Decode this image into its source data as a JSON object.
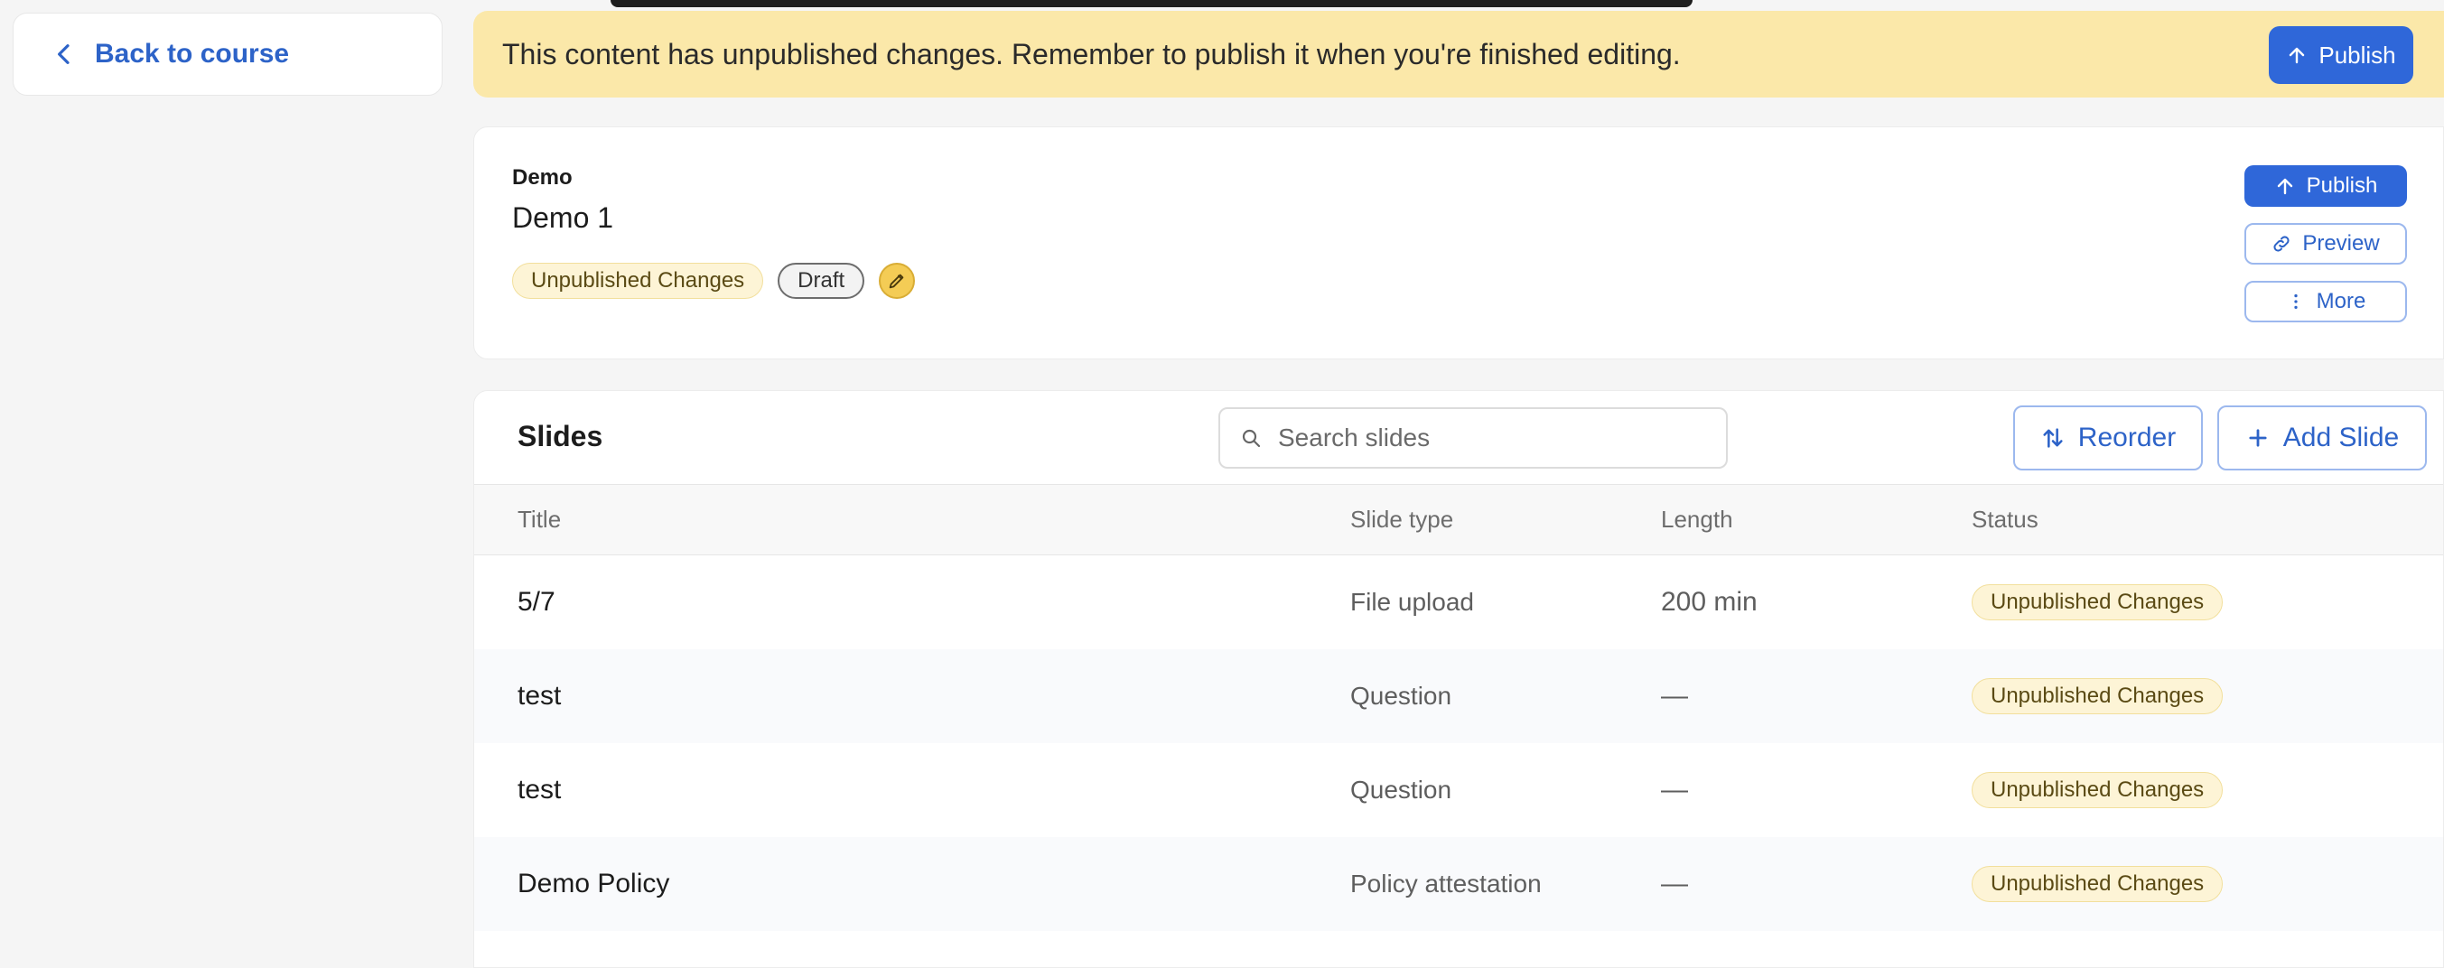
{
  "nav": {
    "back_label": "Back to course"
  },
  "banner": {
    "message": "This content has unpublished changes. Remember to publish it when you're finished editing.",
    "publish_label": "Publish"
  },
  "header": {
    "eyebrow": "Demo",
    "title": "Demo 1",
    "badges": {
      "unpublished": "Unpublished Changes",
      "draft": "Draft"
    },
    "actions": {
      "publish": "Publish",
      "preview": "Preview",
      "more": "More"
    }
  },
  "slides": {
    "heading": "Slides",
    "search_placeholder": "Search slides",
    "reorder_label": "Reorder",
    "add_label": "Add Slide",
    "columns": {
      "title": "Title",
      "type": "Slide type",
      "length": "Length",
      "status": "Status"
    },
    "rows": [
      {
        "title": "5/7",
        "type": "File upload",
        "length": "200 min",
        "status": "Unpublished Changes"
      },
      {
        "title": "test",
        "type": "Question",
        "length": "—",
        "status": "Unpublished Changes"
      },
      {
        "title": "test",
        "type": "Question",
        "length": "—",
        "status": "Unpublished Changes"
      },
      {
        "title": "Demo Policy",
        "type": "Policy attestation",
        "length": "—",
        "status": "Unpublished Changes"
      }
    ]
  },
  "colors": {
    "accent": "#2f67d9",
    "banner_bg": "#fbe8a9",
    "badge_bg": "#fdf4d6"
  }
}
